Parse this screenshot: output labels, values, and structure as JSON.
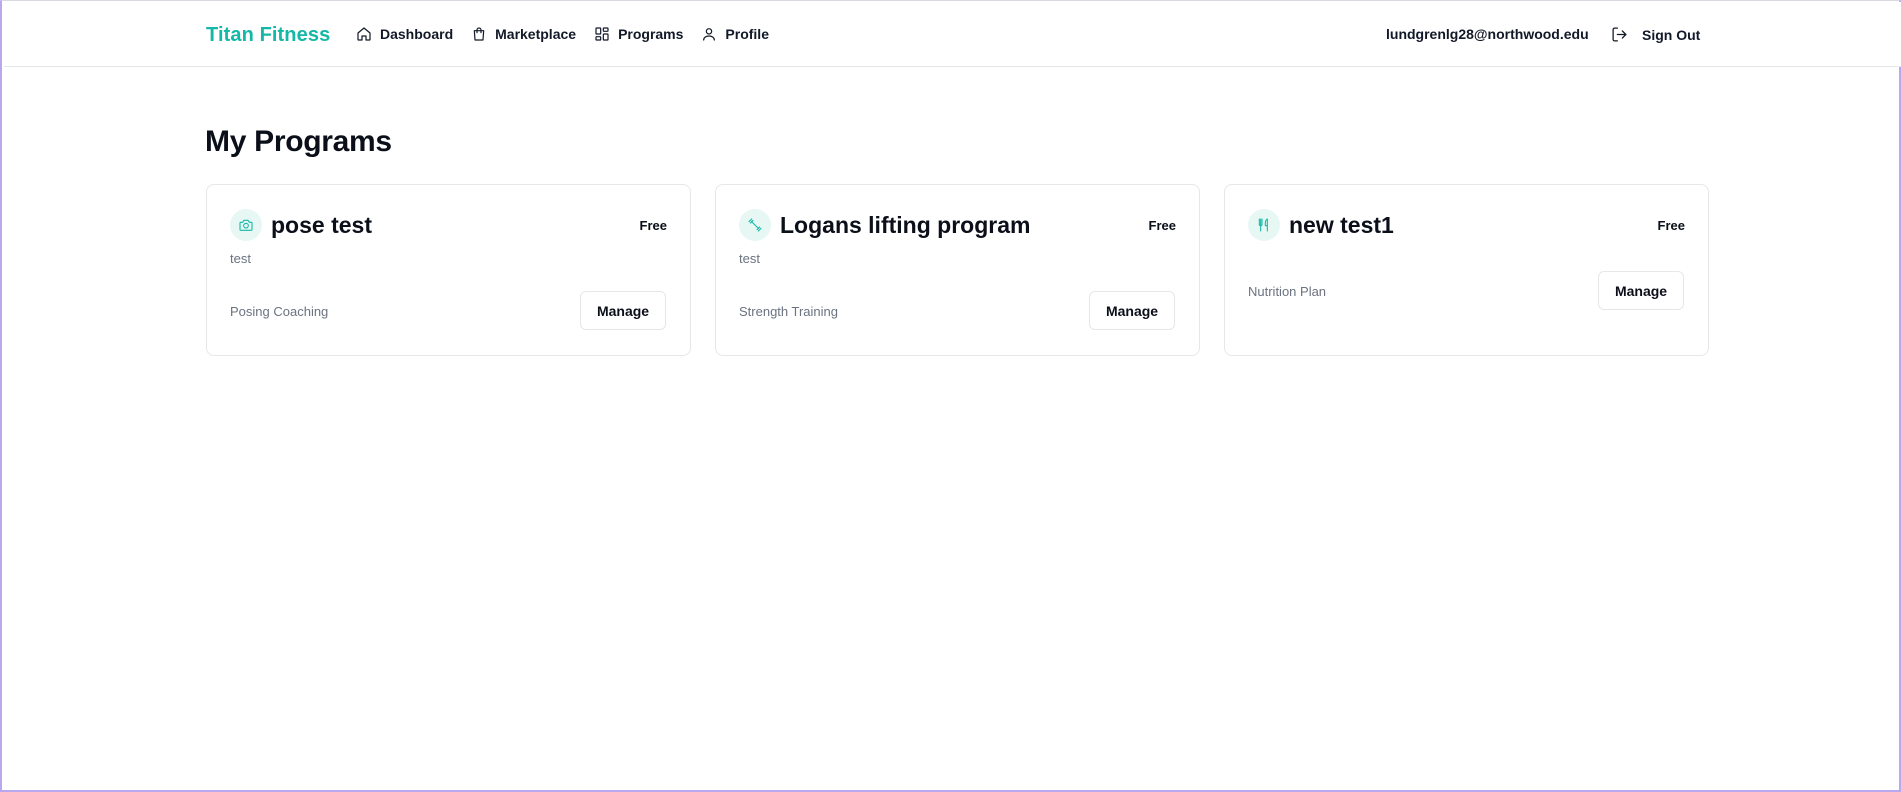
{
  "header": {
    "brand": "Titan Fitness",
    "nav": [
      {
        "label": "Dashboard",
        "icon": "home-icon"
      },
      {
        "label": "Marketplace",
        "icon": "shopping-bag-icon"
      },
      {
        "label": "Programs",
        "icon": "grid-icon"
      },
      {
        "label": "Profile",
        "icon": "user-icon"
      }
    ],
    "user_email": "lundgrenlg28@northwood.edu",
    "sign_out_label": "Sign Out"
  },
  "main": {
    "title": "My Programs",
    "programs": [
      {
        "title": "pose test",
        "price": "Free",
        "description": "test",
        "category": "Posing Coaching",
        "icon": "camera-icon",
        "action_label": "Manage"
      },
      {
        "title": "Logans lifting program",
        "price": "Free",
        "description": "test",
        "category": "Strength Training",
        "icon": "dumbbell-icon",
        "action_label": "Manage"
      },
      {
        "title": "new test1",
        "price": "Free",
        "description": "",
        "category": "Nutrition Plan",
        "icon": "utensils-icon",
        "action_label": "Manage"
      }
    ]
  },
  "colors": {
    "brand": "#14b8a6",
    "icon_bg": "#e6f7f4",
    "muted_text": "#6b7280",
    "border": "#e5e7eb"
  }
}
